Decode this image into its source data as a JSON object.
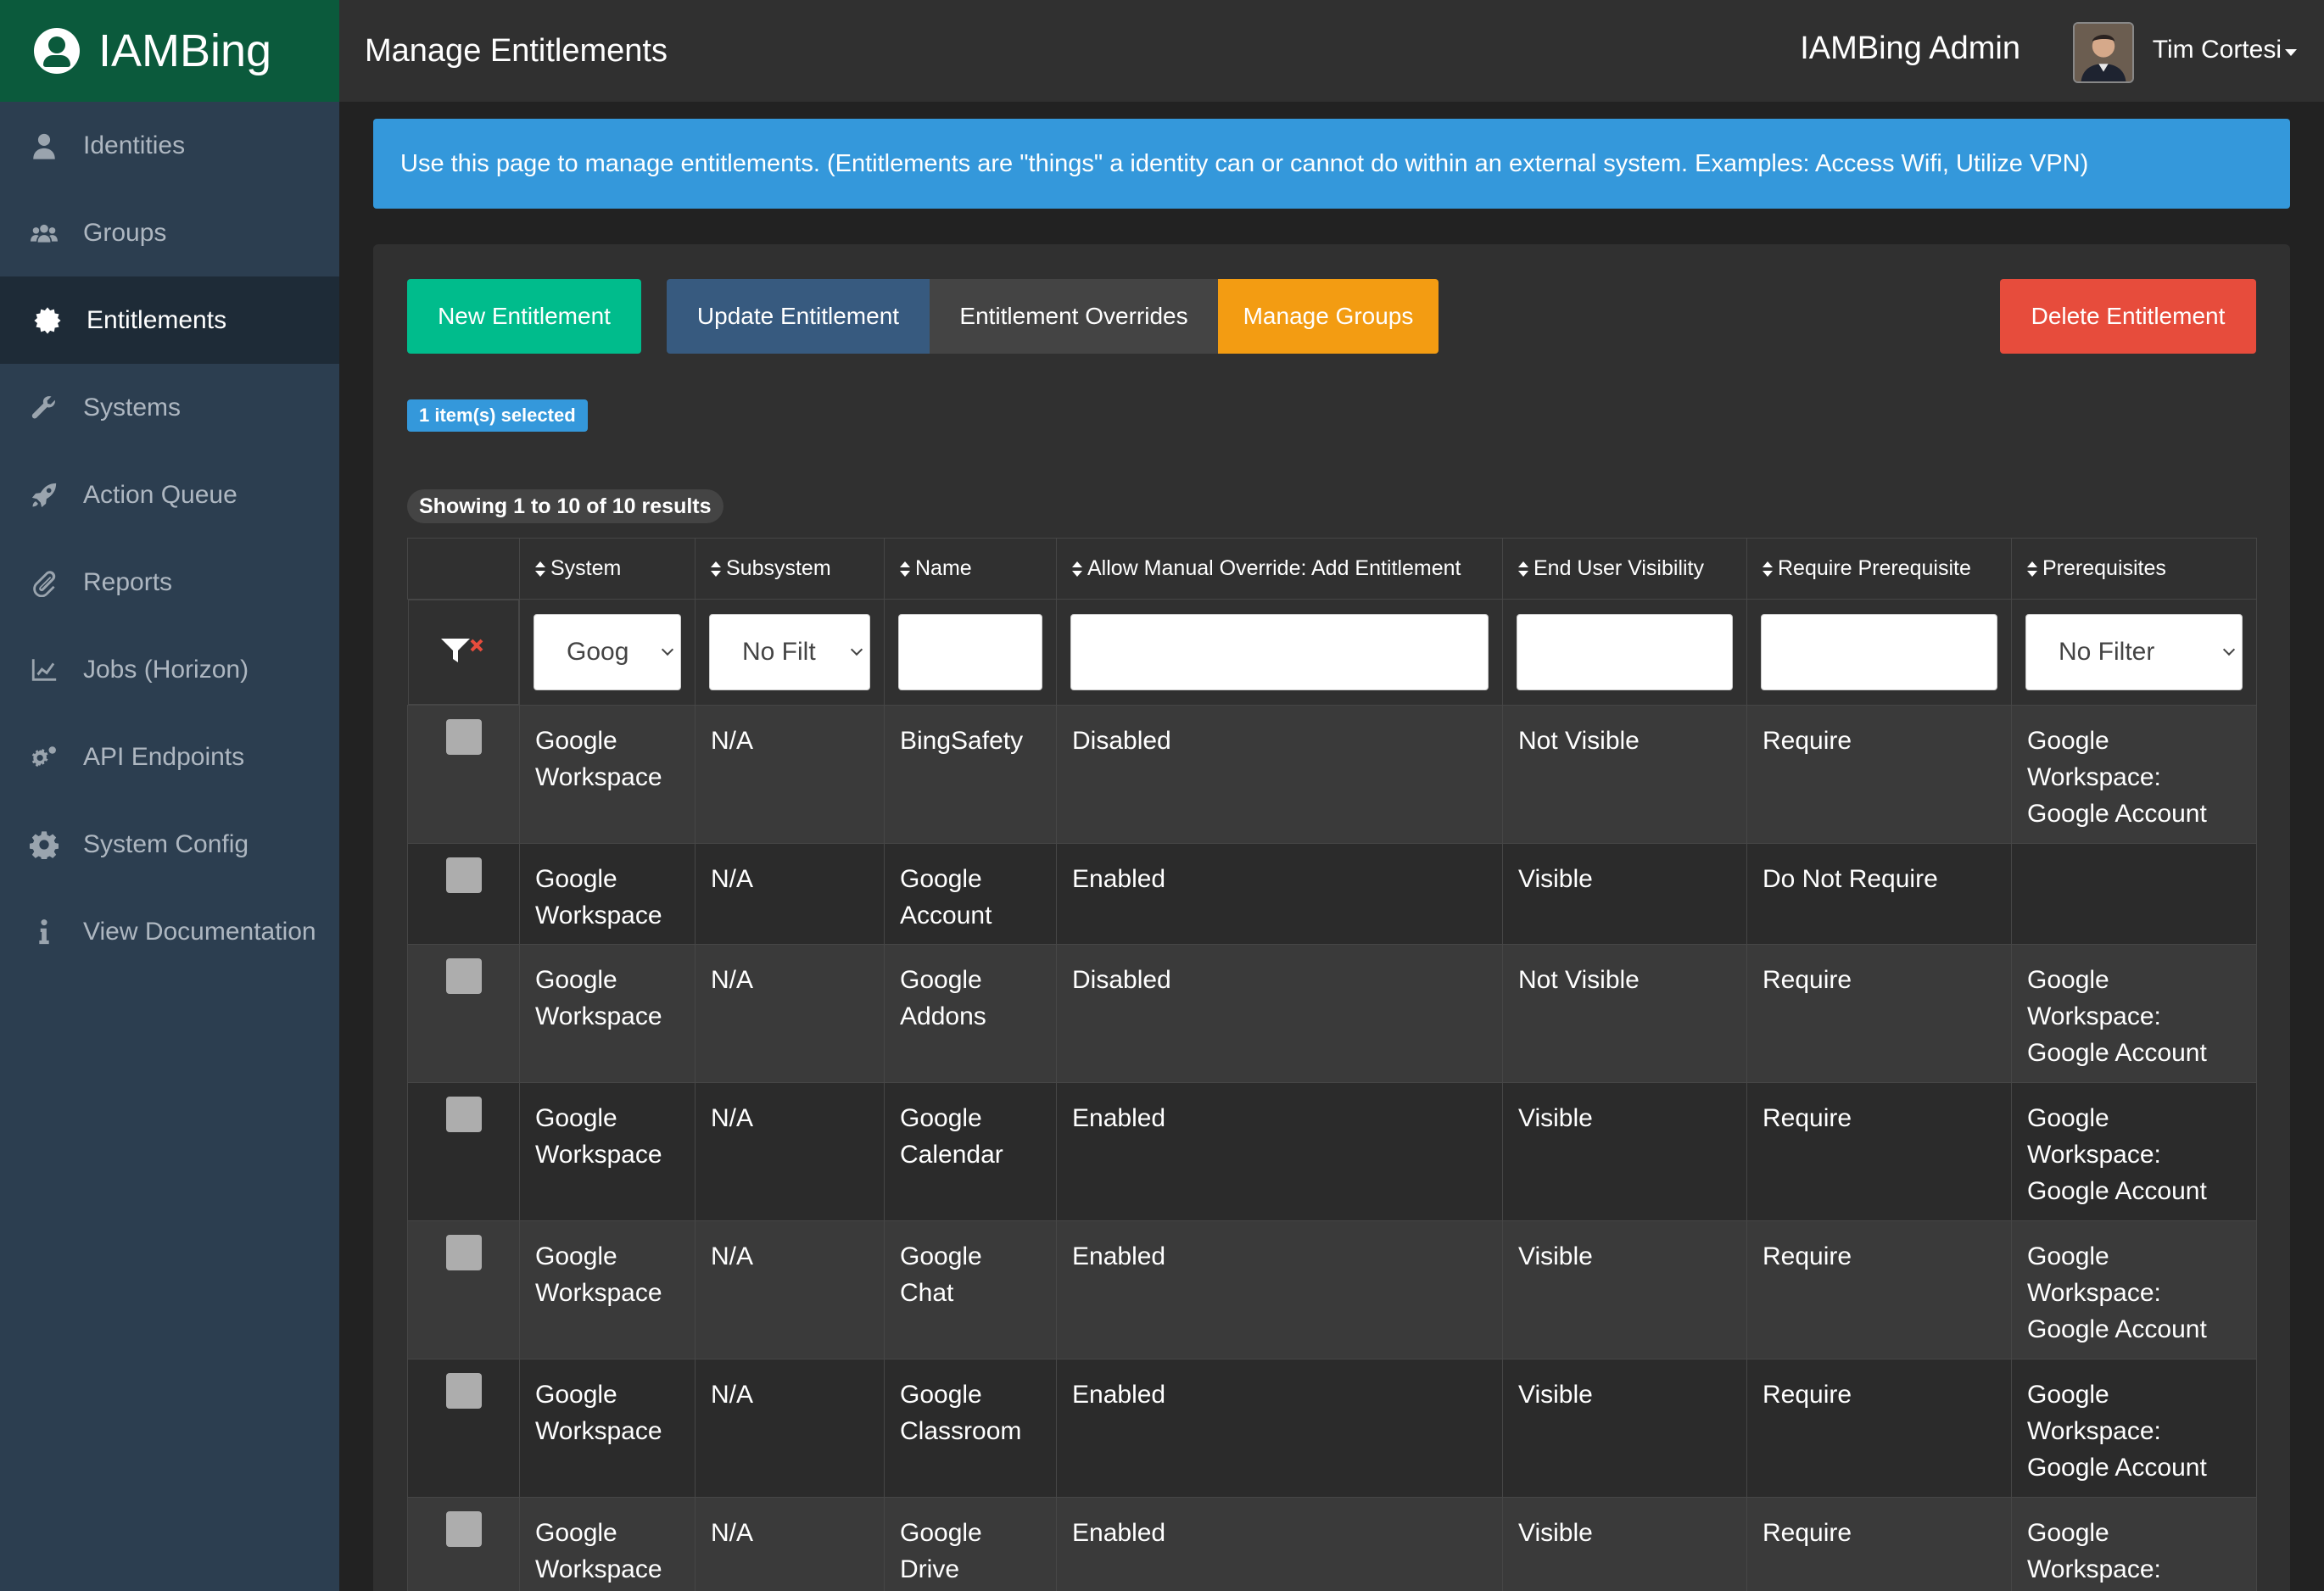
{
  "brand": {
    "name": "IAMBing"
  },
  "sidebar": {
    "items": [
      {
        "label": "Identities",
        "icon": "user-icon",
        "active": false
      },
      {
        "label": "Groups",
        "icon": "users-icon",
        "active": false
      },
      {
        "label": "Entitlements",
        "icon": "certificate-icon",
        "active": true
      },
      {
        "label": "Systems",
        "icon": "wrench-icon",
        "active": false
      },
      {
        "label": "Action Queue",
        "icon": "rocket-icon",
        "active": false
      },
      {
        "label": "Reports",
        "icon": "paperclip-icon",
        "active": false
      },
      {
        "label": "Jobs (Horizon)",
        "icon": "chart-line-icon",
        "active": false
      },
      {
        "label": "API Endpoints",
        "icon": "cogs-icon",
        "active": false
      },
      {
        "label": "System Config",
        "icon": "gear-icon",
        "active": false
      },
      {
        "label": "View Documentation",
        "icon": "info-icon",
        "active": false
      }
    ]
  },
  "header": {
    "title": "Manage Entitlements",
    "admin_label": "IAMBing Admin",
    "user_name": "Tim Cortesi"
  },
  "info_banner": "Use this page to manage entitlements. (Entitlements are \"things\" a identity can or cannot do within an external system. Examples: Access Wifi, Utilize VPN)",
  "toolbar": {
    "new_label": "New Entitlement",
    "update_label": "Update Entitlement",
    "overrides_label": "Entitlement Overrides",
    "groups_label": "Manage Groups",
    "delete_label": "Delete Entitlement"
  },
  "selection_badge": "1 item(s) selected",
  "results_label": "Showing 1 to 10 of 10 results",
  "table": {
    "columns": [
      "System",
      "Subsystem",
      "Name",
      "Allow Manual Override: Add Entitlement",
      "End User Visibility",
      "Require Prerequisite",
      "Prerequisites"
    ],
    "filters": {
      "system": "Goog",
      "subsystem": "No Filt",
      "name": "",
      "override": "",
      "visibility": "",
      "require": "",
      "prerequisites": "No Filter"
    },
    "rows": [
      {
        "system": "Google Workspace",
        "subsystem": "N/A",
        "name": "BingSafety",
        "override": "Disabled",
        "visibility": "Not Visible",
        "require": "Require",
        "prereq": "Google Workspace: Google Account"
      },
      {
        "system": "Google Workspace",
        "subsystem": "N/A",
        "name": "Google Account",
        "override": "Enabled",
        "visibility": "Visible",
        "require": "Do Not Require",
        "prereq": ""
      },
      {
        "system": "Google Workspace",
        "subsystem": "N/A",
        "name": "Google Addons",
        "override": "Disabled",
        "visibility": "Not Visible",
        "require": "Require",
        "prereq": "Google Workspace: Google Account"
      },
      {
        "system": "Google Workspace",
        "subsystem": "N/A",
        "name": "Google Calendar",
        "override": "Enabled",
        "visibility": "Visible",
        "require": "Require",
        "prereq": "Google Workspace: Google Account"
      },
      {
        "system": "Google Workspace",
        "subsystem": "N/A",
        "name": "Google Chat",
        "override": "Enabled",
        "visibility": "Visible",
        "require": "Require",
        "prereq": "Google Workspace: Google Account"
      },
      {
        "system": "Google Workspace",
        "subsystem": "N/A",
        "name": "Google Classroom",
        "override": "Enabled",
        "visibility": "Visible",
        "require": "Require",
        "prereq": "Google Workspace: Google Account"
      },
      {
        "system": "Google Workspace",
        "subsystem": "N/A",
        "name": "Google Drive",
        "override": "Enabled",
        "visibility": "Visible",
        "require": "Require",
        "prereq": "Google Workspace:"
      }
    ]
  },
  "colors": {
    "sidebar_bg": "#2c3e50",
    "brand_bg": "#0b5a3c",
    "info": "#3498db",
    "success": "#00bc8c",
    "primary": "#375a7f",
    "warning": "#f39c12",
    "danger": "#e74c3c"
  }
}
